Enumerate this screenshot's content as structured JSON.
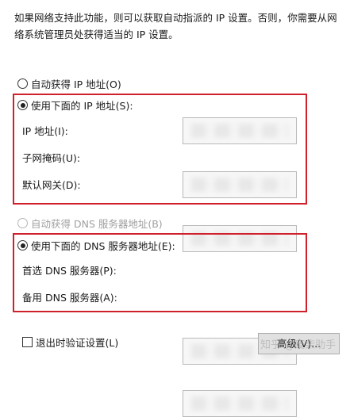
{
  "description": "如果网络支持此功能，则可以获取自动指派的 IP 设置。否则，你需要从网络系统管理员处获得适当的 IP 设置。",
  "ip": {
    "auto_label": "自动获得 IP 地址(O)",
    "manual_label": "使用下面的 IP 地址(S):",
    "selected": "manual",
    "fields": [
      {
        "label": "IP 地址(I):",
        "value": ""
      },
      {
        "label": "子网掩码(U):",
        "value": ""
      },
      {
        "label": "默认网关(D):",
        "value": ""
      }
    ]
  },
  "dns": {
    "auto_label": "自动获得 DNS 服务器地址(B)",
    "manual_label": "使用下面的 DNS 服务器地址(E):",
    "selected": "manual",
    "fields": [
      {
        "label": "首选 DNS 服务器(P):",
        "value": ""
      },
      {
        "label": "备用 DNS 服务器(A):",
        "value": ""
      }
    ]
  },
  "validate_label": "退出时验证设置(L)",
  "validate_checked": false,
  "advanced_label": "高级(V)...",
  "watermark": "知乎 @废柴助手",
  "colors": {
    "highlight": "#d0202c",
    "button": "#e1e1e1",
    "disabled_text": "#a0a0a0"
  }
}
